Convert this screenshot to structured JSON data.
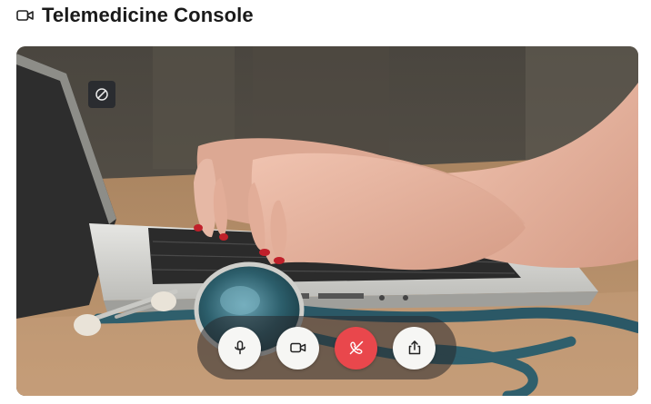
{
  "header": {
    "icon": "video-camera-icon",
    "title": "Telemedicine Console"
  },
  "video": {
    "badge_icon": "blocked-icon",
    "background_colors": {
      "wall": "#3f3c36",
      "desk": "#b08864",
      "laptop": "#d9d9d6",
      "skin": "#e4b3a0",
      "stethoscope": "#2f5f6c"
    }
  },
  "controls": {
    "buttons": [
      {
        "name": "mute-button",
        "icon": "microphone-icon"
      },
      {
        "name": "camera-button",
        "icon": "video-camera-icon"
      },
      {
        "name": "end-call-button",
        "icon": "phone-off-icon",
        "color": "#e9474c"
      },
      {
        "name": "share-screen-button",
        "icon": "share-icon"
      }
    ]
  }
}
